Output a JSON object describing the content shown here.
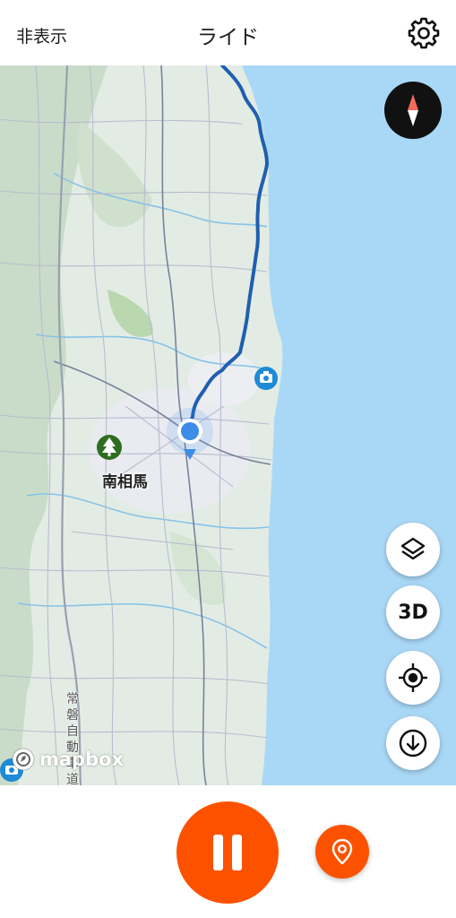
{
  "header": {
    "hide_label": "非表示",
    "title": "ライド",
    "settings_icon": "gear-icon"
  },
  "map": {
    "city_label": "南相馬",
    "expressway_label": "常磐自動車道",
    "attribution": "mapbox",
    "colors": {
      "sea": "#a9d8f6",
      "land": "#dfe9e2",
      "route": "#1f5fb0",
      "location": "#3d8ce8",
      "poi_camera": "#1f8ad6",
      "park": "#2e6e1f"
    },
    "controls": {
      "compass_icon": "compass-icon",
      "layers_icon": "layers-icon",
      "three_d_label": "3D",
      "locate_icon": "crosshair-icon",
      "download_icon": "download-icon"
    }
  },
  "bottom": {
    "pause_icon": "pause-icon",
    "pin_icon": "map-pin-icon",
    "accent": "#fc5200"
  }
}
